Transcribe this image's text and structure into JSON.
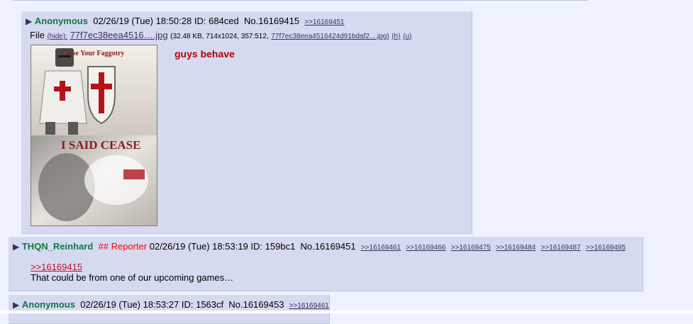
{
  "posts": [
    {
      "name": "Anonymous",
      "datetime": "02/26/19 (Tue) 18:50:28",
      "id_label": "ID: 684ced",
      "no_label": "No.16169415",
      "backlinks": [
        ">>16169451"
      ],
      "file": {
        "prefix": "File",
        "hide": "(hide):",
        "filename": "77f7ec38eea4516….jpg",
        "meta": "(32.48 KB, 714x1024, 357:512,",
        "full_name": "77f7ec38eea4516424d91bdaf2....jpg)",
        "h": "(h)",
        "u": "(u)"
      },
      "image_caption_top": "Cease Your Faggotry",
      "image_caption_bottom": "I SAID CEASE",
      "message": "guys behave"
    },
    {
      "name": "THQN_Reinhard",
      "capcode": "## Reporter",
      "datetime": "02/26/19 (Tue) 18:53:19",
      "id_label": "ID: 159bc1",
      "no_label": "No.16169451",
      "backlinks": [
        ">>16169461",
        ">>16169466",
        ">>16169475",
        ">>16169484",
        ">>16169487",
        ">>16169495"
      ],
      "quote": ">>16169415",
      "message": "That could be from one of our upcoming games…"
    },
    {
      "name": "Anonymous",
      "datetime": "02/26/19 (Tue) 18:53:27",
      "id_label": "ID: 1563cf",
      "no_label": "No.16169453",
      "backlinks": [
        ">>16169461"
      ]
    }
  ]
}
